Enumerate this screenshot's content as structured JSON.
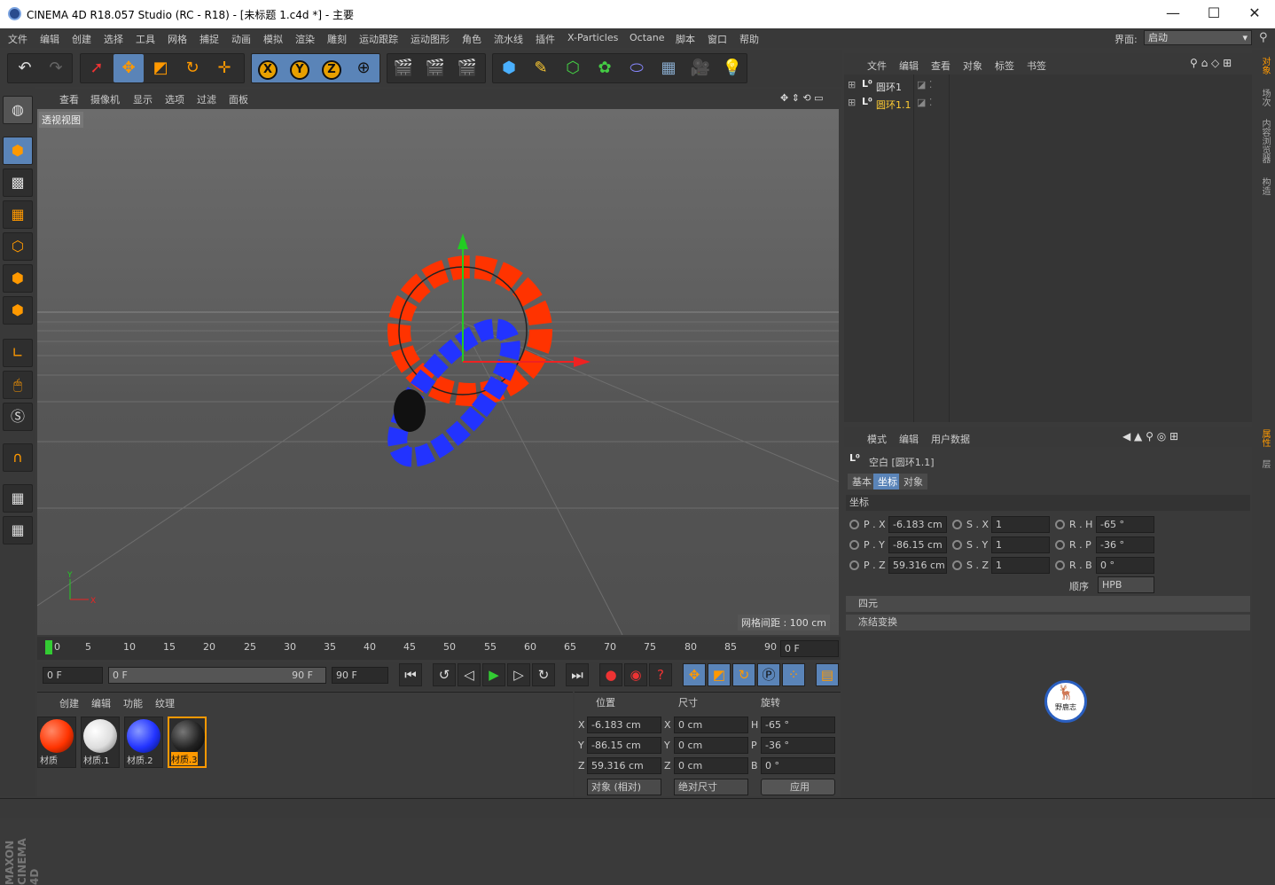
{
  "titlebar": {
    "title": "CINEMA 4D R18.057 Studio (RC - R18) - [未标题 1.c4d *] - 主要",
    "minimize": "—",
    "maximize": "☐",
    "close": "✕"
  },
  "menu": {
    "items": [
      "文件",
      "编辑",
      "创建",
      "选择",
      "工具",
      "网格",
      "捕捉",
      "动画",
      "模拟",
      "渲染",
      "雕刻",
      "运动跟踪",
      "运动图形",
      "角色",
      "流水线",
      "插件",
      "X-Particles",
      "Octane",
      "脚本",
      "窗口",
      "帮助"
    ],
    "layout_label": "界面:",
    "layout_value": "启动"
  },
  "viewport": {
    "menu": [
      "查看",
      "摄像机",
      "显示",
      "选项",
      "过滤",
      "面板"
    ],
    "label": "透视视图",
    "grid_info": "网格间距 : 100 cm",
    "axis_y": "Y",
    "axis_x": "X"
  },
  "timeline": {
    "ticks": [
      "0",
      "5",
      "10",
      "15",
      "20",
      "25",
      "30",
      "35",
      "40",
      "45",
      "50",
      "55",
      "60",
      "65",
      "70",
      "75",
      "80",
      "85",
      "90"
    ],
    "current_frame": "0 F",
    "start": "0 F",
    "range_start": "0 F",
    "range_end": "90 F",
    "end": "90 F"
  },
  "materials": {
    "menu": [
      "创建",
      "编辑",
      "功能",
      "纹理"
    ],
    "items": [
      {
        "name": "材质",
        "color": "#ff3300"
      },
      {
        "name": "材质.1",
        "color": "#ffffff"
      },
      {
        "name": "材质.2",
        "color": "#2233ff"
      },
      {
        "name": "材质.3",
        "color": "#222222"
      }
    ]
  },
  "coords": {
    "headers": [
      "位置",
      "尺寸",
      "旋转"
    ],
    "rows": [
      {
        "a": "X",
        "pos": "-6.183 cm",
        "b": "X",
        "size": "0 cm",
        "c": "H",
        "rot": "-65 °"
      },
      {
        "a": "Y",
        "pos": "-86.15 cm",
        "b": "Y",
        "size": "0 cm",
        "c": "P",
        "rot": "-36 °"
      },
      {
        "a": "Z",
        "pos": "59.316 cm",
        "b": "Z",
        "size": "0 cm",
        "c": "B",
        "rot": "0 °"
      }
    ],
    "mode": "对象 (相对)",
    "size_mode": "绝对尺寸",
    "apply": "应用"
  },
  "objects": {
    "menu": [
      "文件",
      "编辑",
      "查看",
      "对象",
      "标签",
      "书签"
    ],
    "rows": [
      {
        "name": "圆环1"
      },
      {
        "name": "圆环1.1"
      }
    ]
  },
  "attributes": {
    "menu": [
      "模式",
      "编辑",
      "用户数据"
    ],
    "object": "空白 [圆环1.1]",
    "tabs": [
      "基本",
      "坐标",
      "对象"
    ],
    "section": "坐标",
    "params": [
      {
        "l1": "P . X",
        "v1": "-6.183 cm",
        "l2": "S . X",
        "v2": "1",
        "l3": "R . H",
        "v3": "-65 °"
      },
      {
        "l1": "P . Y",
        "v1": "-86.15 cm",
        "l2": "S . Y",
        "v2": "1",
        "l3": "R . P",
        "v3": "-36 °"
      },
      {
        "l1": "P . Z",
        "v1": "59.316 cm",
        "l2": "S . Z",
        "v2": "1",
        "l3": "R . B",
        "v3": "0 °"
      }
    ],
    "order_label": "顺序",
    "order_value": "HPB",
    "collapsed": [
      "四元",
      "冻结变换"
    ]
  },
  "right_tabs": [
    "对象",
    "场次",
    "内容浏览器",
    "构造"
  ],
  "right_tabs2": [
    "属性",
    "层"
  ],
  "maxon": "MAXON CINEMA 4D",
  "badge": "野鹿志"
}
